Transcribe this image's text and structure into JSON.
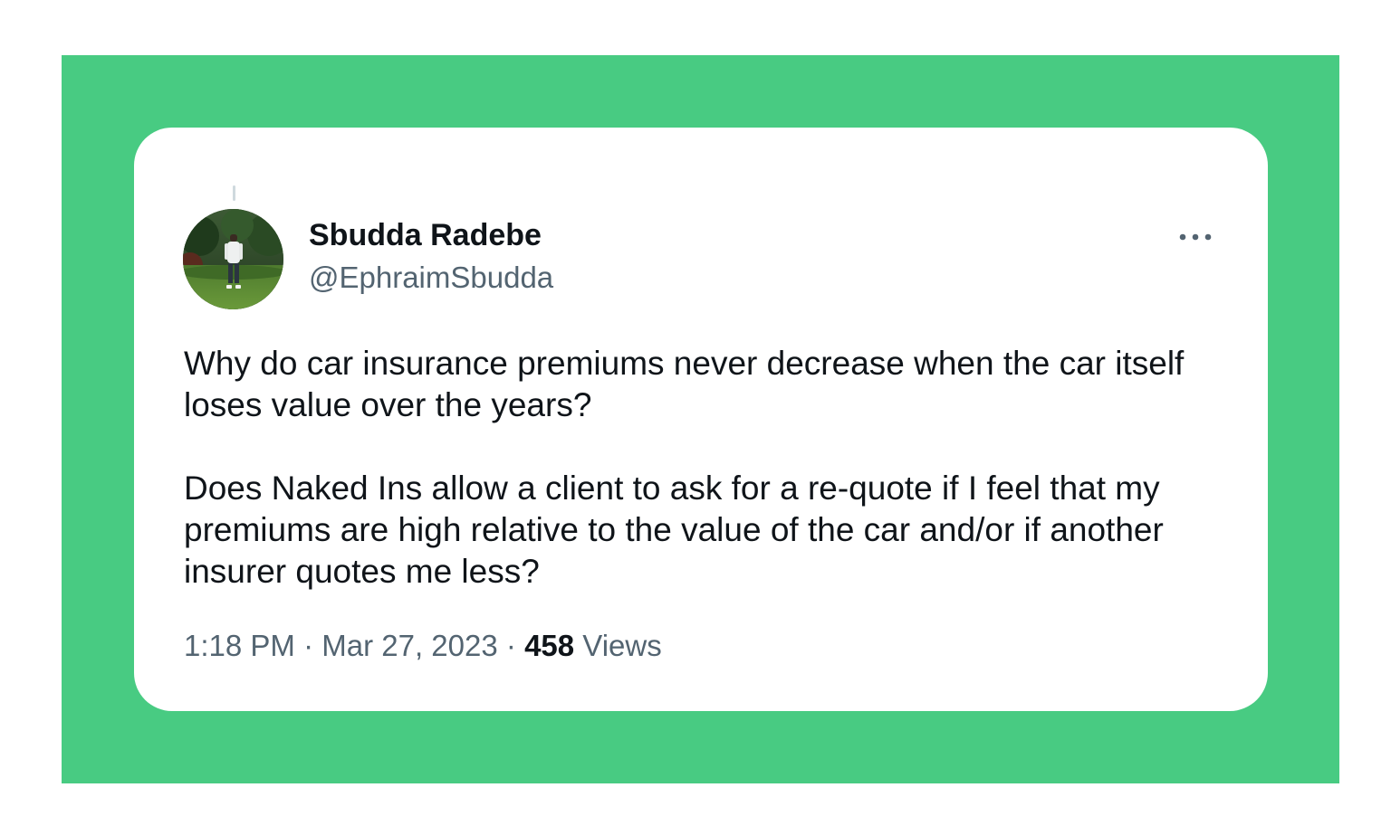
{
  "tweet": {
    "author": {
      "display_name": "Sbudda Radebe",
      "handle": "@EphraimSbudda"
    },
    "text_paragraphs": [
      "Why do car insurance premiums never decrease when the car itself loses value over the years?",
      "Does Naked Ins allow a client to ask for a re-quote if I feel that my premiums are high relative to the value of the car and/or if another insurer quotes me less?"
    ],
    "time": "1:18 PM",
    "separator": "·",
    "date": "Mar 27, 2023",
    "views_count": "458",
    "views_label": "Views",
    "more_icon": "more-horizontal-icon"
  },
  "colors": {
    "frame_green": "#48cb82",
    "card": "#ffffff",
    "primary_text": "#0f1419",
    "secondary_text": "#536471"
  }
}
